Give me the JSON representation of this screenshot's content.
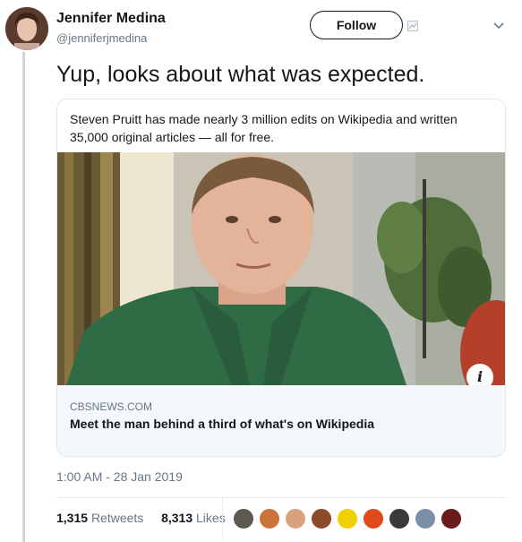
{
  "tweet": {
    "author_name": "Jennifer Medina",
    "author_handle": "@jenniferjmedina",
    "follow_label": "Follow",
    "text": "Yup, looks about what was expected.",
    "timestamp": "1:00 AM - 28 Jan 2019"
  },
  "card": {
    "quote": "Steven Pruitt has made nearly 3 million edits on Wikipedia and written 35,000 original articles — all for free.",
    "domain": "CBSNEWS.COM",
    "title": "Meet the man behind a third of what's on Wikipedia",
    "info_glyph": "i"
  },
  "stats": {
    "retweets_count": "1,315",
    "retweets_label": "Retweets",
    "likes_count": "8,313",
    "likes_label": "Likes"
  },
  "colors": {
    "handle_gray": "#657786",
    "card_border": "#e1e8ed",
    "card_footer_bg": "#f5f8fa",
    "shirt_green": "#2f6b44"
  },
  "icons": [
    "avatar",
    "broken-image-icon",
    "chevron-down-icon",
    "info-icon",
    "liker-avatar"
  ]
}
